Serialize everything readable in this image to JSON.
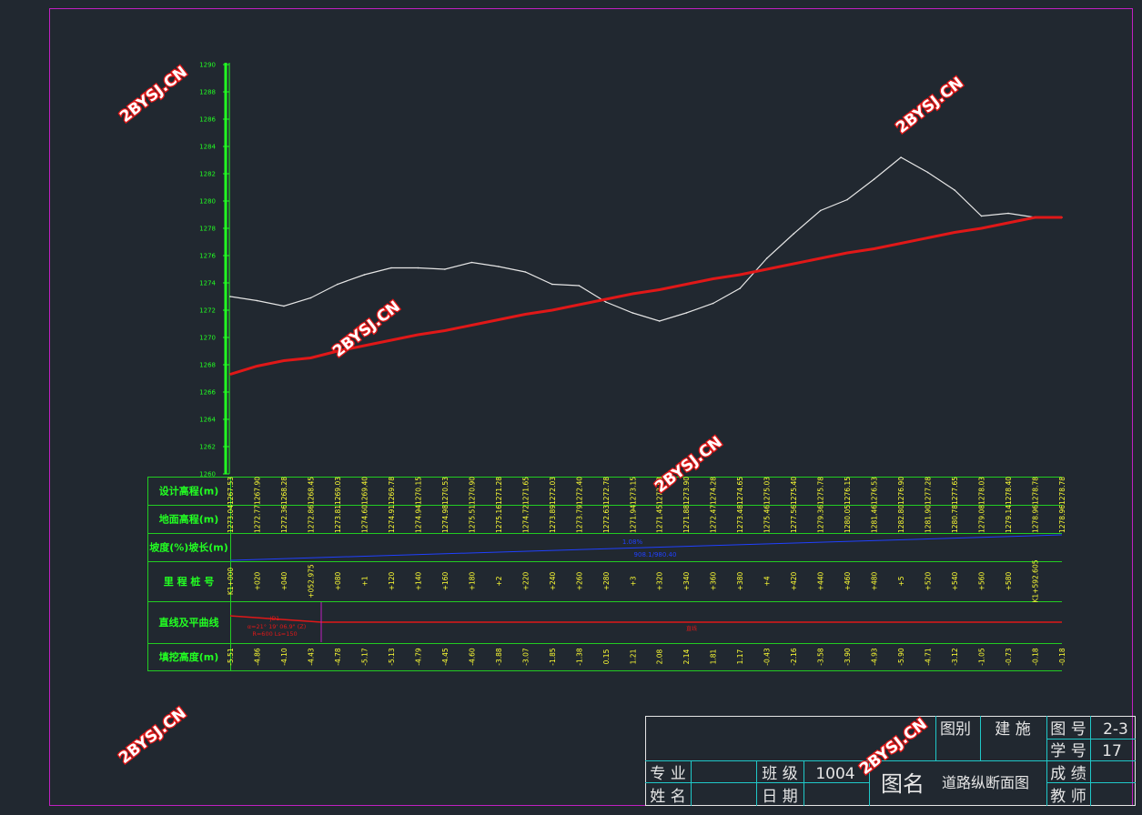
{
  "watermark": "2BYSJ.CN",
  "colors": {
    "background": "#212830",
    "frame": "#c020c0",
    "axis": "#22ff22",
    "ground_line": "#e6e6e6",
    "design_line": "#e01818",
    "table_grid": "#22cc22",
    "table_label": "#22ff22",
    "table_value": "#ffff33",
    "grade_line": "#2040ff",
    "curve_line": "#e01818",
    "title_block": "#e6e6e6",
    "title_grid": "#20c8c8"
  },
  "chart_data": {
    "type": "line",
    "y_ticks": [
      1260,
      1262,
      1264,
      1266,
      1268,
      1270,
      1272,
      1274,
      1276,
      1278,
      1280,
      1282,
      1284,
      1286,
      1288,
      1290
    ],
    "ylim": [
      1260,
      1290
    ],
    "series": [
      {
        "role": "ground",
        "values": [
          1273.0,
          1272.7,
          1272.3,
          1272.9,
          1273.9,
          1274.6,
          1275.1,
          1275.1,
          1275.0,
          1275.5,
          1275.2,
          1274.8,
          1273.9,
          1273.8,
          1272.6,
          1271.8,
          1271.2,
          1271.8,
          1272.5,
          1273.6,
          1275.8,
          1277.6,
          1279.3,
          1280.1,
          1281.6,
          1283.2,
          1282.1,
          1280.8,
          1278.9,
          1279.1,
          1278.8,
          1278.8
        ]
      },
      {
        "role": "design",
        "values": [
          1267.3,
          1267.9,
          1268.3,
          1268.5,
          1269.0,
          1269.4,
          1269.8,
          1270.2,
          1270.5,
          1270.9,
          1271.3,
          1271.7,
          1272.0,
          1272.4,
          1272.8,
          1273.2,
          1273.5,
          1273.9,
          1274.3,
          1274.6,
          1275.0,
          1275.4,
          1275.8,
          1276.2,
          1276.5,
          1276.9,
          1277.3,
          1277.7,
          1278.0,
          1278.4,
          1278.8,
          1278.8
        ]
      }
    ]
  },
  "profile_table": {
    "labels": [
      "设计高程(m)",
      "地面高程(m)",
      "坡度(%)坡长(m)",
      "里 程 桩 号",
      "直线及平曲线",
      "填挖高度(m)"
    ],
    "design_elev": [
      "1267.53",
      "1267.90",
      "1268.28",
      "1268.45",
      "1269.03",
      "1269.40",
      "1269.78",
      "1270.15",
      "1270.53",
      "1270.90",
      "1271.28",
      "1271.65",
      "1272.03",
      "1272.40",
      "1272.78",
      "1273.15",
      "1273.53",
      "1273.90",
      "1274.28",
      "1274.65",
      "1275.03",
      "1275.40",
      "1275.78",
      "1276.15",
      "1276.53",
      "1276.90",
      "1277.28",
      "1277.65",
      "1278.03",
      "1278.40",
      "1278.78",
      "1278.78"
    ],
    "ground_elev": [
      "1273.04",
      "1272.77",
      "1272.36",
      "1272.86",
      "1273.81",
      "1274.60",
      "1274.91",
      "1274.94",
      "1274.98",
      "1275.51",
      "1275.16",
      "1274.72",
      "1273.89",
      "1273.79",
      "1272.63",
      "1271.94",
      "1271.45",
      "1271.88",
      "1272.47",
      "1273.48",
      "1275.46",
      "1277.56",
      "1279.36",
      "1280.05",
      "1281.46",
      "1282.80",
      "1281.90",
      "1280.78",
      "1279.08",
      "1279.14",
      "1278.96",
      "1278.96"
    ],
    "grade": {
      "percent": "1.08%",
      "length": "908.1/980.40"
    },
    "stations": [
      "K1+000",
      "+020",
      "+040",
      "+052.975",
      "+080",
      "+1",
      "+120",
      "+140",
      "+160",
      "+180",
      "+2",
      "+220",
      "+240",
      "+260",
      "+280",
      "+3",
      "+320",
      "+340",
      "+360",
      "+380",
      "+4",
      "+420",
      "+440",
      "+460",
      "+480",
      "+5",
      "+520",
      "+540",
      "+560",
      "+580",
      "K1+592.605",
      ""
    ],
    "curve": {
      "name": "JD1",
      "formula1": "α=21° 19' 06.9\" (Z)",
      "formula2": "R=600  Ls=150",
      "straight": "直线"
    },
    "fill_cut": [
      "-5.51",
      "-4.86",
      "-4.10",
      "-4.43",
      "-4.78",
      "-5.17",
      "-5.13",
      "-4.79",
      "-4.45",
      "-4.60",
      "-3.88",
      "-3.07",
      "-1.85",
      "-1.38",
      "0.15",
      "1.21",
      "2.08",
      "2.14",
      "1.81",
      "1.17",
      "-0.43",
      "-2.16",
      "-3.58",
      "-3.90",
      "-4.93",
      "-5.90",
      "-4.71",
      "-3.12",
      "-1.05",
      "-0.73",
      "-0.18",
      "-0.18"
    ]
  },
  "title_block": {
    "category_label": "图别",
    "category_value": "建 施",
    "drawing_no_label": "图 号",
    "drawing_no_value": "2-3",
    "student_no_label": "学 号",
    "student_no_value": "17",
    "major_label": "专 业",
    "major_value": "",
    "class_label": "班 级",
    "class_value": "1004",
    "name_label": "姓 名",
    "name_value": "",
    "date_label": "日 期",
    "date_value": "",
    "drawing_name_label": "图名",
    "drawing_name_value": "道路纵断面图",
    "score_label": "成 绩",
    "score_value": "",
    "teacher_label": "教 师",
    "teacher_value": ""
  }
}
